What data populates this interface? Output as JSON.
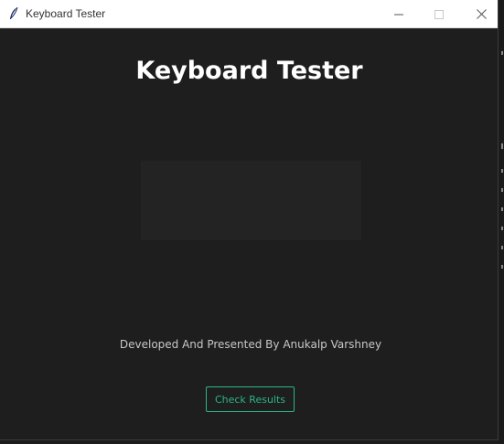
{
  "window": {
    "title": "Keyboard Tester",
    "icon": "feather-icon",
    "controls": [
      "minimize-icon",
      "maximize-icon",
      "close-icon"
    ]
  },
  "main": {
    "heading": "Keyboard Tester",
    "credits": "Developed And Presented By Anukalp Varshney",
    "check_button_label": "Check Results"
  },
  "colors": {
    "background": "#1e1e1e",
    "display_box": "#232323",
    "accent": "#2bb58a",
    "heading": "#ffffff",
    "credits": "#c8c8c8"
  }
}
